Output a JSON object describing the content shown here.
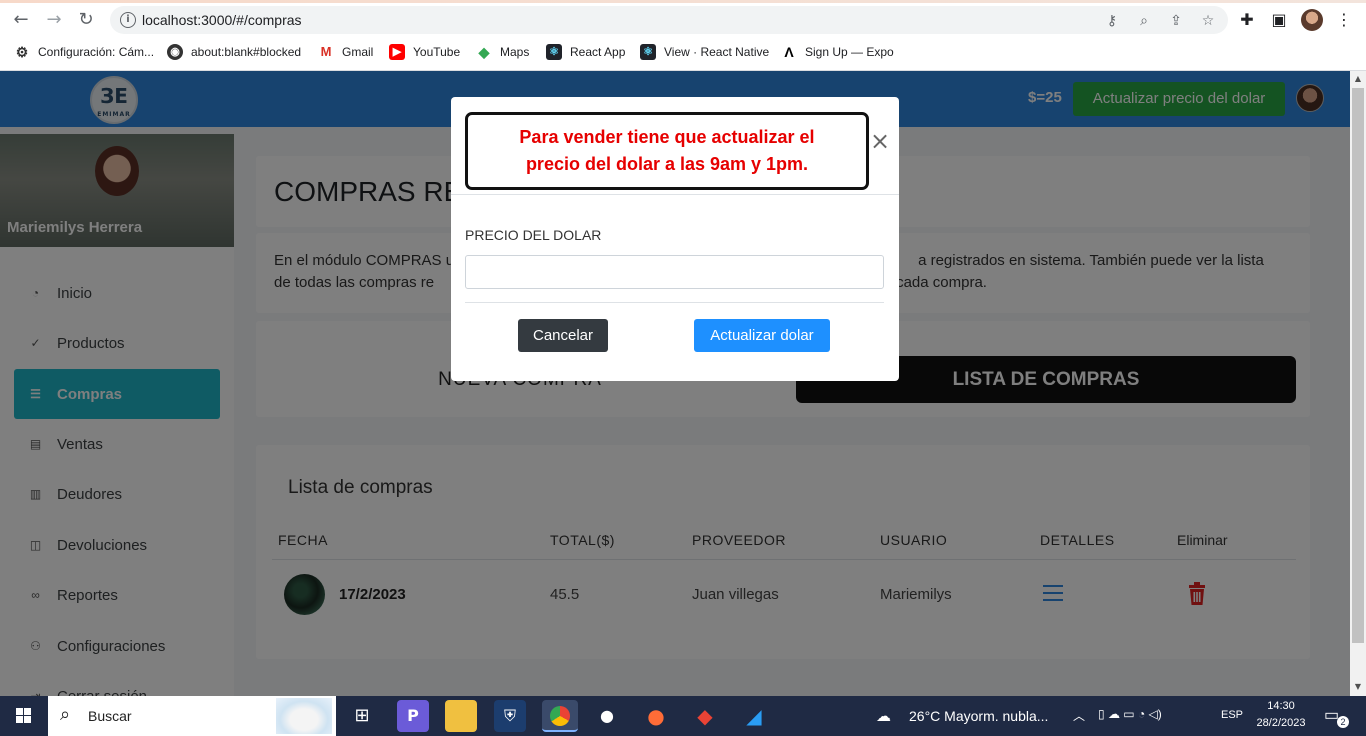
{
  "browser": {
    "url": "localhost:3000/#/compras",
    "bookmarks": [
      {
        "label": "Configuración: Cám...",
        "icon": "gear-icon"
      },
      {
        "label": "about:blank#blocked",
        "icon": "globe-icon"
      },
      {
        "label": "Gmail",
        "icon": "gmail-icon"
      },
      {
        "label": "YouTube",
        "icon": "youtube-icon"
      },
      {
        "label": "Maps",
        "icon": "maps-icon"
      },
      {
        "label": "React App",
        "icon": "react-icon"
      },
      {
        "label": "View · React Native",
        "icon": "react-icon"
      },
      {
        "label": "Sign Up — Expo",
        "icon": "expo-icon"
      }
    ]
  },
  "navbar": {
    "logo_mark": "ЗE",
    "logo_text": "EMIMAR",
    "dollar_rate": "$=25",
    "update_button": "Actualizar precio del dolar",
    "colors": {
      "bar": "#2e86de",
      "update": "#28a745"
    }
  },
  "sidebar": {
    "user_name": "Mariemilys Herrera",
    "items": [
      {
        "label": "Inicio",
        "icon": "dashboard-icon"
      },
      {
        "label": "Productos",
        "icon": "check-circle-icon"
      },
      {
        "label": "Compras",
        "icon": "list-icon",
        "active": true
      },
      {
        "label": "Ventas",
        "icon": "receipt-icon"
      },
      {
        "label": "Deudores",
        "icon": "book-icon"
      },
      {
        "label": "Devoluciones",
        "icon": "book-open-icon"
      },
      {
        "label": "Reportes",
        "icon": "link-icon"
      },
      {
        "label": "Configuraciones",
        "icon": "users-icon"
      },
      {
        "label": "Cerrar sesión",
        "icon": "logout-icon"
      }
    ]
  },
  "main": {
    "title": "COMPRAS RE",
    "description_left": "En el módulo COMPRAS u",
    "description_right": "a registrados en sistema. También puede ver la lista",
    "description_left2": "de todas las compras re",
    "description_right2": "cada compra.",
    "tab_new": "NUEVA COMPRA",
    "tab_list": "LISTA DE COMPRAS",
    "list_title": "Lista de compras",
    "table": {
      "headers": [
        "FECHA",
        "TOTAL($)",
        "PROVEEDOR",
        "USUARIO",
        "DETALLES",
        "Eliminar"
      ],
      "rows": [
        {
          "fecha": "17/2/2023",
          "total": "45.5",
          "proveedor": "Juan villegas",
          "usuario": "Mariemilys"
        }
      ]
    }
  },
  "modal": {
    "alert_line1": "Para vender tiene que actualizar el",
    "alert_line2": "precio del dolar a las 9am y 1pm.",
    "field_label": "PRECIO DEL DOLAR",
    "field_value": "",
    "cancel_button": "Cancelar",
    "update_button": "Actualizar dolar"
  },
  "taskbar": {
    "search_label": "Buscar",
    "weather": "26°C  Mayorm. nubla...",
    "language": "ESP",
    "time": "14:30",
    "date": "28/2/2023",
    "notifications": "2"
  }
}
